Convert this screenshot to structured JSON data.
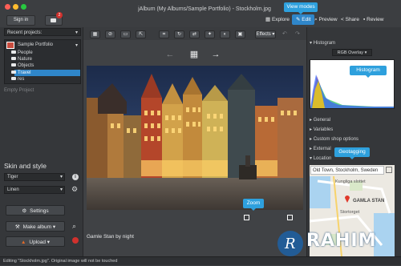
{
  "window": {
    "title": "jAlbum (My Albums/Sample Portfolio) - Stockholm.jpg",
    "sign_in": "Sign in",
    "chat_badge": "2"
  },
  "top_nav": {
    "explore": "Explore",
    "edit": "Edit",
    "preview": "Preview",
    "share": "Share",
    "review": "Review"
  },
  "callouts": {
    "view_modes": "View modes",
    "histogram": "Histogram",
    "geotagging": "Geotagging",
    "zoom": "Zoom"
  },
  "left_panel": {
    "recent_projects": "Recent projects:",
    "tree": {
      "project": "Sample Portfolio",
      "folders": [
        "People",
        "Nature",
        "Objects",
        "Travel",
        "res"
      ],
      "selected": "Travel"
    },
    "empty_project": "Empty Project",
    "skin_title": "Skin and style",
    "skin": "Tiger",
    "style": "Linen",
    "buttons": {
      "settings": "Settings",
      "make_album": "Make album",
      "upload": "Upload"
    }
  },
  "toolbar": {
    "effects": "Effects"
  },
  "viewer": {
    "caption": "Gamle Stan by night"
  },
  "right_panel": {
    "histogram_label": "Histogram",
    "rgb_select": "RGB Overlay",
    "sections": [
      "General",
      "Variables",
      "Custom shop options",
      "External",
      "Location"
    ],
    "location_value": "Old Town, Stockholm, Sweden",
    "map_labels": {
      "street1": "Kungliga slottet",
      "district": "GAMLA STAN",
      "street2": "Stortorget"
    }
  },
  "status_bar": {
    "text": "Editing \"Stockholm.jpg\". Original image will not be touched"
  },
  "watermark": {
    "brand": "RAHIM"
  },
  "colors": {
    "accent": "#2f86c9",
    "callout": "#2ea0dd",
    "badge": "#d0312d"
  }
}
